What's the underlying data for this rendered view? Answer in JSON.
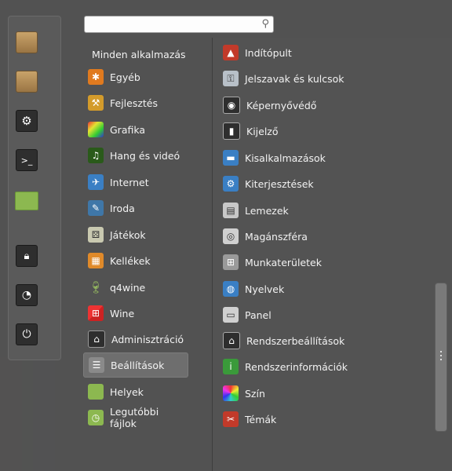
{
  "search": {
    "value": "",
    "placeholder": ""
  },
  "categories": [
    {
      "label": "Minden alkalmazás",
      "icon": "none"
    },
    {
      "label": "Egyéb",
      "icon": "misc-icon",
      "color": "#e07a1f"
    },
    {
      "label": "Fejlesztés",
      "icon": "development-icon",
      "color": "#d39b2b"
    },
    {
      "label": "Grafika",
      "icon": "graphics-icon",
      "color": "#c24fc4"
    },
    {
      "label": "Hang és videó",
      "icon": "multimedia-icon",
      "color": "#3a8a2a"
    },
    {
      "label": "Internet",
      "icon": "internet-icon",
      "color": "#3a7fc4"
    },
    {
      "label": "Iroda",
      "icon": "office-icon",
      "color": "#3f77a8"
    },
    {
      "label": "Játékok",
      "icon": "games-icon",
      "color": "#c9c9b0"
    },
    {
      "label": "Kellékek",
      "icon": "accessories-icon",
      "color": "#e08a2a"
    },
    {
      "label": "q4wine",
      "icon": "wine-glass-icon",
      "color": "#7aa050"
    },
    {
      "label": "Wine",
      "icon": "wine-icon",
      "color": "#c23a2a"
    },
    {
      "label": "Adminisztráció",
      "icon": "administration-icon",
      "color": "#2e2e2e"
    },
    {
      "label": "Beállítások",
      "icon": "settings-icon",
      "color": "#8a8a8a"
    },
    {
      "label": "Helyek",
      "icon": "folder-icon",
      "color": "#8cb850"
    },
    {
      "label": "Legutóbbi fájlok",
      "icon": "recent-folder-icon",
      "color": "#8cb850"
    }
  ],
  "selected_category": "Beállítások",
  "apps": [
    {
      "label": "Indítópult",
      "icon": "launcher-icon",
      "color": "#c23a2a"
    },
    {
      "label": "Jelszavak és kulcsok",
      "icon": "keys-icon",
      "color": "#b8c0c8"
    },
    {
      "label": "Képernyővédő",
      "icon": "screensaver-icon",
      "color": "#2e2e2e"
    },
    {
      "label": "Kijelző",
      "icon": "display-icon",
      "color": "#2e2e2e"
    },
    {
      "label": "Kisalkalmazások",
      "icon": "applets-icon",
      "color": "#3a7fc4"
    },
    {
      "label": "Kiterjesztések",
      "icon": "extensions-icon",
      "color": "#3a7fc4"
    },
    {
      "label": "Lemezek",
      "icon": "disks-icon",
      "color": "#c8c8c8"
    },
    {
      "label": "Magánszféra",
      "icon": "privacy-icon",
      "color": "#d0d0d0"
    },
    {
      "label": "Munkaterületek",
      "icon": "workspaces-icon",
      "color": "#9a9a9a"
    },
    {
      "label": "Nyelvek",
      "icon": "languages-icon",
      "color": "#3a7fc4"
    },
    {
      "label": "Panel",
      "icon": "panel-icon",
      "color": "#d0d0d0"
    },
    {
      "label": "Rendszerbeállítások",
      "icon": "system-settings-icon",
      "color": "#2e2e2e"
    },
    {
      "label": "Rendszerinformációk",
      "icon": "system-info-icon",
      "color": "#3a9a3a"
    },
    {
      "label": "Szín",
      "icon": "color-icon",
      "color": "#e0c040"
    },
    {
      "label": "Témák",
      "icon": "themes-icon",
      "color": "#c23a2a"
    }
  ],
  "favorites": [
    {
      "icon": "package-install-icon"
    },
    {
      "icon": "package-manager-icon"
    },
    {
      "icon": "system-settings-icon"
    },
    {
      "icon": "terminal-icon"
    },
    {
      "icon": "home-folder-icon"
    },
    {
      "icon": "lock-screen-icon"
    },
    {
      "icon": "logout-icon"
    },
    {
      "icon": "shutdown-icon"
    }
  ]
}
